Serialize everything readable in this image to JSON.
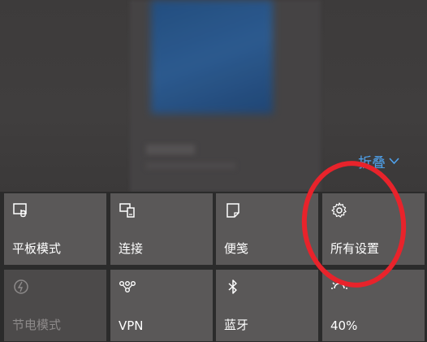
{
  "notification_area": {
    "collapse_label": "折叠",
    "collapse_icon": "chevron-down-icon"
  },
  "quick_actions": {
    "row1": [
      {
        "label": "平板模式",
        "icon": "tablet-mode-icon"
      },
      {
        "label": "连接",
        "icon": "connect-icon"
      },
      {
        "label": "便笺",
        "icon": "note-icon"
      },
      {
        "label": "所有设置",
        "icon": "gear-icon"
      }
    ],
    "row2": [
      {
        "label": "节电模式",
        "icon": "battery-saver-icon",
        "disabled": true
      },
      {
        "label": "VPN",
        "icon": "vpn-icon"
      },
      {
        "label": "蓝牙",
        "icon": "bluetooth-icon"
      },
      {
        "label": "40%",
        "icon": "brightness-icon"
      }
    ]
  },
  "colors": {
    "tile_bg": "#5a5858",
    "tile_dim_bg": "#4c4a4a",
    "accent_blue": "#4fa3ee",
    "highlight_red": "#e8232b"
  }
}
